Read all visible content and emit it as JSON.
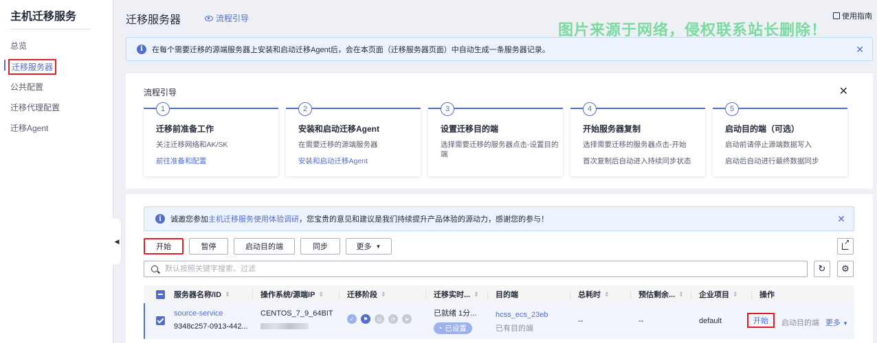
{
  "sidebar": {
    "title": "主机迁移服务",
    "items": [
      {
        "label": "总览"
      },
      {
        "label": "迁移服务器"
      },
      {
        "label": "公共配置"
      },
      {
        "label": "迁移代理配置"
      },
      {
        "label": "迁移Agent"
      }
    ]
  },
  "header": {
    "title": "迁移服务器",
    "guide_link": "流程引导",
    "help_link": "使用指南",
    "watermark": "图片来源于网络，侵权联系站长删除！"
  },
  "info_banner": {
    "text": "在每个需要迁移的源端服务器上安装和启动迁移Agent后，会在本页面（迁移服务器页面）中自动生成一条服务器记录。"
  },
  "process_guide": {
    "title": "流程引导",
    "steps": [
      {
        "num": "1",
        "title": "迁移前准备工作",
        "desc": "关注迁移网络和AK/SK",
        "link": "前往准备和配置"
      },
      {
        "num": "2",
        "title": "安装和启动迁移Agent",
        "desc": "在需要迁移的源端服务器",
        "link": "安装和启动迁移Agent"
      },
      {
        "num": "3",
        "title": "设置迁移目的端",
        "desc": "选择需要迁移的服务器点击-设置目的端"
      },
      {
        "num": "4",
        "title": "开始服务器复制",
        "desc": "选择需要迁移的服务器点击-开始",
        "desc2": "首次复制后自动进入持续同步状态"
      },
      {
        "num": "5",
        "title": "启动目的端（可选）",
        "desc": "启动前请停止源端数据写入",
        "desc2": "启动后自动进行最终数据同步"
      }
    ]
  },
  "survey": {
    "prefix": "诚邀您参加",
    "link": "主机迁移服务使用体验调研",
    "suffix": "，您宝贵的意见和建议是我们持续提升产品体验的源动力，感谢您的参与！"
  },
  "toolbar": {
    "start": "开始",
    "pause": "暂停",
    "launch_target": "启动目的端",
    "sync": "同步",
    "more": "更多"
  },
  "search": {
    "placeholder": "默认按照关键字搜索、过滤"
  },
  "table": {
    "columns": [
      "服务器名称/ID",
      "操作系统/源端IP",
      "迁移阶段",
      "迁移实时...",
      "目的端",
      "总耗时",
      "预估剩余...",
      "企业项目",
      "操作"
    ],
    "rows": [
      {
        "name": "source-service",
        "id": "9348c257-0913-442...",
        "os": "CENTOS_7_9_64BIT",
        "realtime_status": "已就绪 1分...",
        "realtime_tag": "已设置",
        "target": "hcss_ecs_23eb",
        "target_status": "已有目的端",
        "total_time": "--",
        "remaining": "--",
        "project": "default",
        "action_start": "开始",
        "action_launch": "启动目的端",
        "action_more": "更多"
      }
    ]
  },
  "colors": {
    "accent": "#526ecc",
    "highlight_border": "#e02020",
    "watermark": "#1ec85a"
  }
}
